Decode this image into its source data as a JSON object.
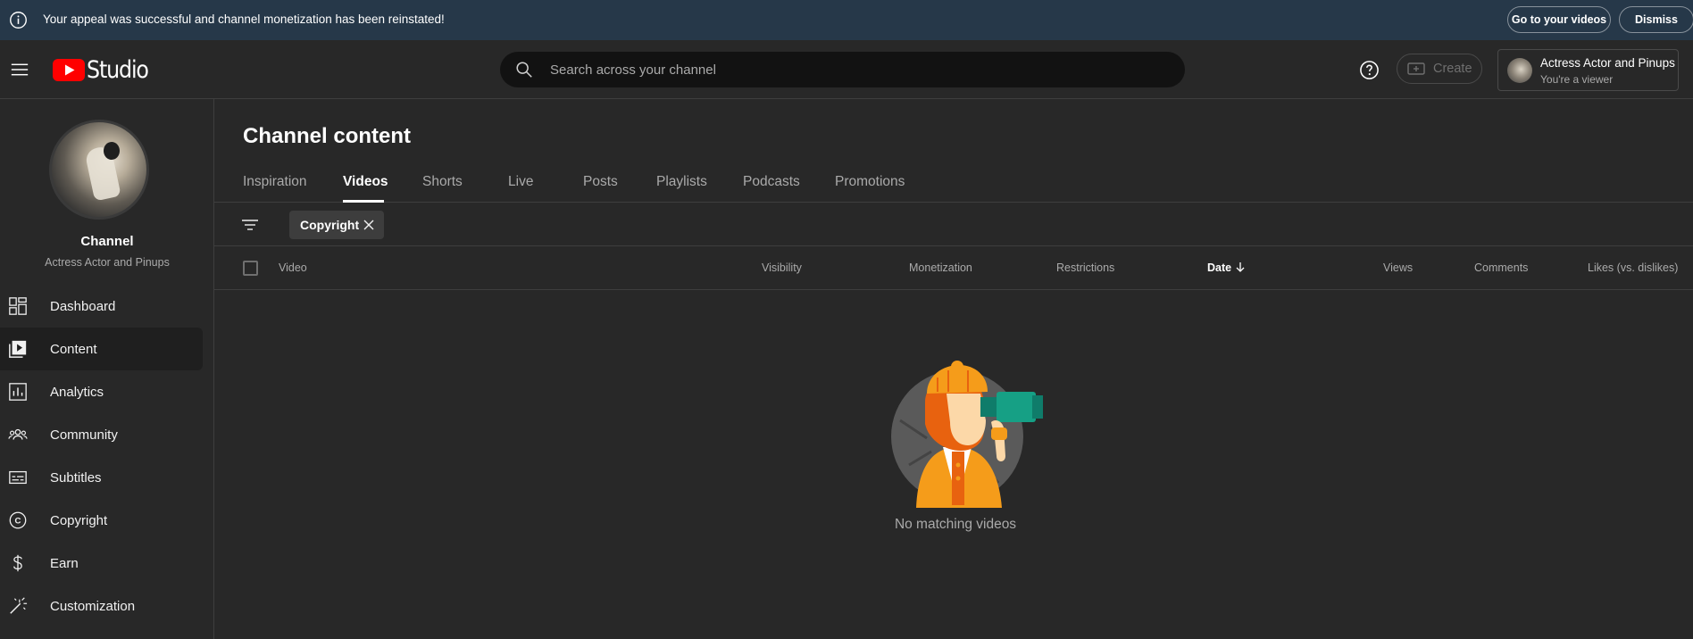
{
  "banner": {
    "message": "Your appeal was successful and channel monetization has been reinstated!",
    "go_label": "Go to your videos",
    "dismiss_label": "Dismiss"
  },
  "header": {
    "logo_text": "Studio",
    "search_placeholder": "Search across your channel",
    "create_label": "Create",
    "account_name": "Actress Actor and Pinups",
    "account_role": "You're a viewer"
  },
  "sidebar": {
    "channel_label": "Channel",
    "channel_name": "Actress Actor and Pinups",
    "items": [
      {
        "label": "Dashboard",
        "icon": "dashboard-icon"
      },
      {
        "label": "Content",
        "icon": "content-icon",
        "active": true
      },
      {
        "label": "Analytics",
        "icon": "analytics-icon"
      },
      {
        "label": "Community",
        "icon": "community-icon"
      },
      {
        "label": "Subtitles",
        "icon": "subtitles-icon"
      },
      {
        "label": "Copyright",
        "icon": "copyright-icon"
      },
      {
        "label": "Earn",
        "icon": "earn-icon"
      },
      {
        "label": "Customization",
        "icon": "customization-icon"
      }
    ]
  },
  "main": {
    "title": "Channel content",
    "tabs": [
      "Inspiration",
      "Videos",
      "Shorts",
      "Live",
      "Posts",
      "Playlists",
      "Podcasts",
      "Promotions"
    ],
    "active_tab": "Videos",
    "filter_chip": "Copyright",
    "columns": {
      "video": "Video",
      "visibility": "Visibility",
      "monetization": "Monetization",
      "restrictions": "Restrictions",
      "date": "Date",
      "views": "Views",
      "comments": "Comments",
      "likes": "Likes (vs. dislikes)"
    },
    "empty_message": "No matching videos"
  },
  "colors": {
    "banner_bg": "#263849",
    "background": "#282828",
    "search_bg": "#121212",
    "youtube_red": "#ff0000",
    "accent_orange": "#f59c1a",
    "accent_teal": "#16a085"
  }
}
